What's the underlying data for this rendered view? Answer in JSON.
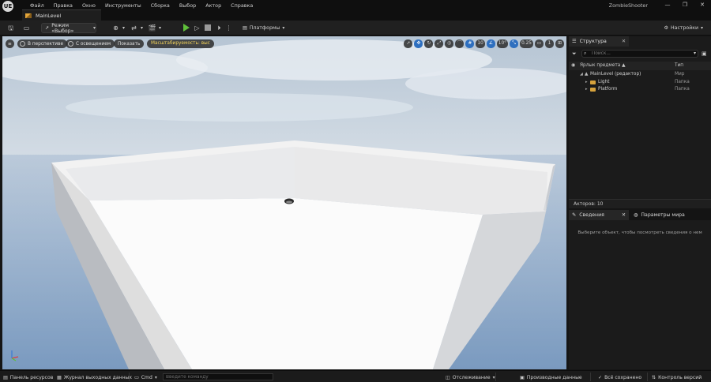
{
  "titlebar": {
    "logo": "UE",
    "menu": [
      "Файл",
      "Правка",
      "Окно",
      "Инструменты",
      "Сборка",
      "Выбор",
      "Актор",
      "Справка"
    ],
    "app_title": "ZombieShooter",
    "window_controls": [
      "—",
      "❐",
      "✕"
    ],
    "doc_tab": "MainLevel"
  },
  "toolbar": {
    "mode_label": "Режим «Выбор»",
    "platforms_label": "Платформы",
    "settings_label": "Настройки"
  },
  "viewport": {
    "perspective_label": "В перспективе",
    "lit_label": "С освещением",
    "show_label": "Показать",
    "scalability_label": "Масштабируемость: выс",
    "grid_snap_value": "10",
    "rotation_snap_value": "10°",
    "scale_snap_value": "0.25",
    "camera_speed_value": "1"
  },
  "outliner": {
    "tab_label": "Структура",
    "search_placeholder": "Поиск...",
    "col_name": "Ярлык предмета ▲",
    "col_type": "Тип",
    "rows": [
      {
        "name": "MainLevel (редактор)",
        "type": "Мир"
      },
      {
        "name": "Light",
        "type": "Папка"
      },
      {
        "name": "Platform",
        "type": "Папка"
      }
    ],
    "actor_count": "Акторов: 10"
  },
  "details": {
    "tab_details": "Сведения",
    "tab_world": "Параметры мира",
    "empty_text": "Выберите объект, чтобы посмотреть сведения о нем"
  },
  "statusbar": {
    "content_browser": "Панель ресурсов",
    "output_log": "Журнал выходных данных",
    "cmd_label": "Cmd",
    "cmd_placeholder": "Введите команду",
    "trace": "Отслеживание",
    "derived_data": "Производные данные",
    "saved": "Всё сохранено",
    "source_control": "Контроль версий"
  },
  "colors": {
    "accent": "#2e6fbf",
    "play": "#5fbf3a",
    "folder": "#d6a23c",
    "scalability_text": "#f2d25a"
  }
}
